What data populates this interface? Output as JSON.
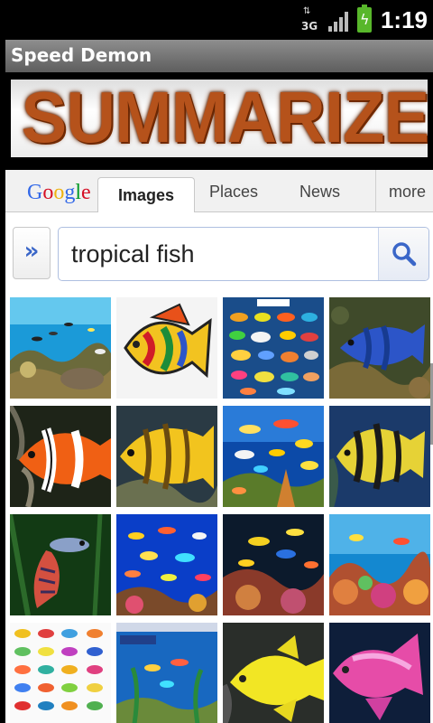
{
  "status_bar": {
    "network_label": "3G",
    "time": "1:19",
    "icons": [
      "data-arrows-icon",
      "signal-icon",
      "battery-charging-icon"
    ]
  },
  "app": {
    "title": "Speed Demon",
    "banner_text": "SUMMARIZE"
  },
  "google": {
    "logo": "Google",
    "tabs": [
      {
        "label": "Images",
        "active": true
      },
      {
        "label": "Places",
        "active": false
      },
      {
        "label": "News",
        "active": false
      },
      {
        "label": "more",
        "active": false
      }
    ],
    "expand_label": "»",
    "search_value": "tropical fish",
    "search_icon": "search-icon"
  },
  "results": {
    "count_visible": 16,
    "colors": {
      "ocean": "#1d8ad0",
      "reef": "#5a6c2a",
      "tang_blue": "#2a55c0",
      "clownfish": "#f06010",
      "yellow": "#f4d21a"
    }
  }
}
